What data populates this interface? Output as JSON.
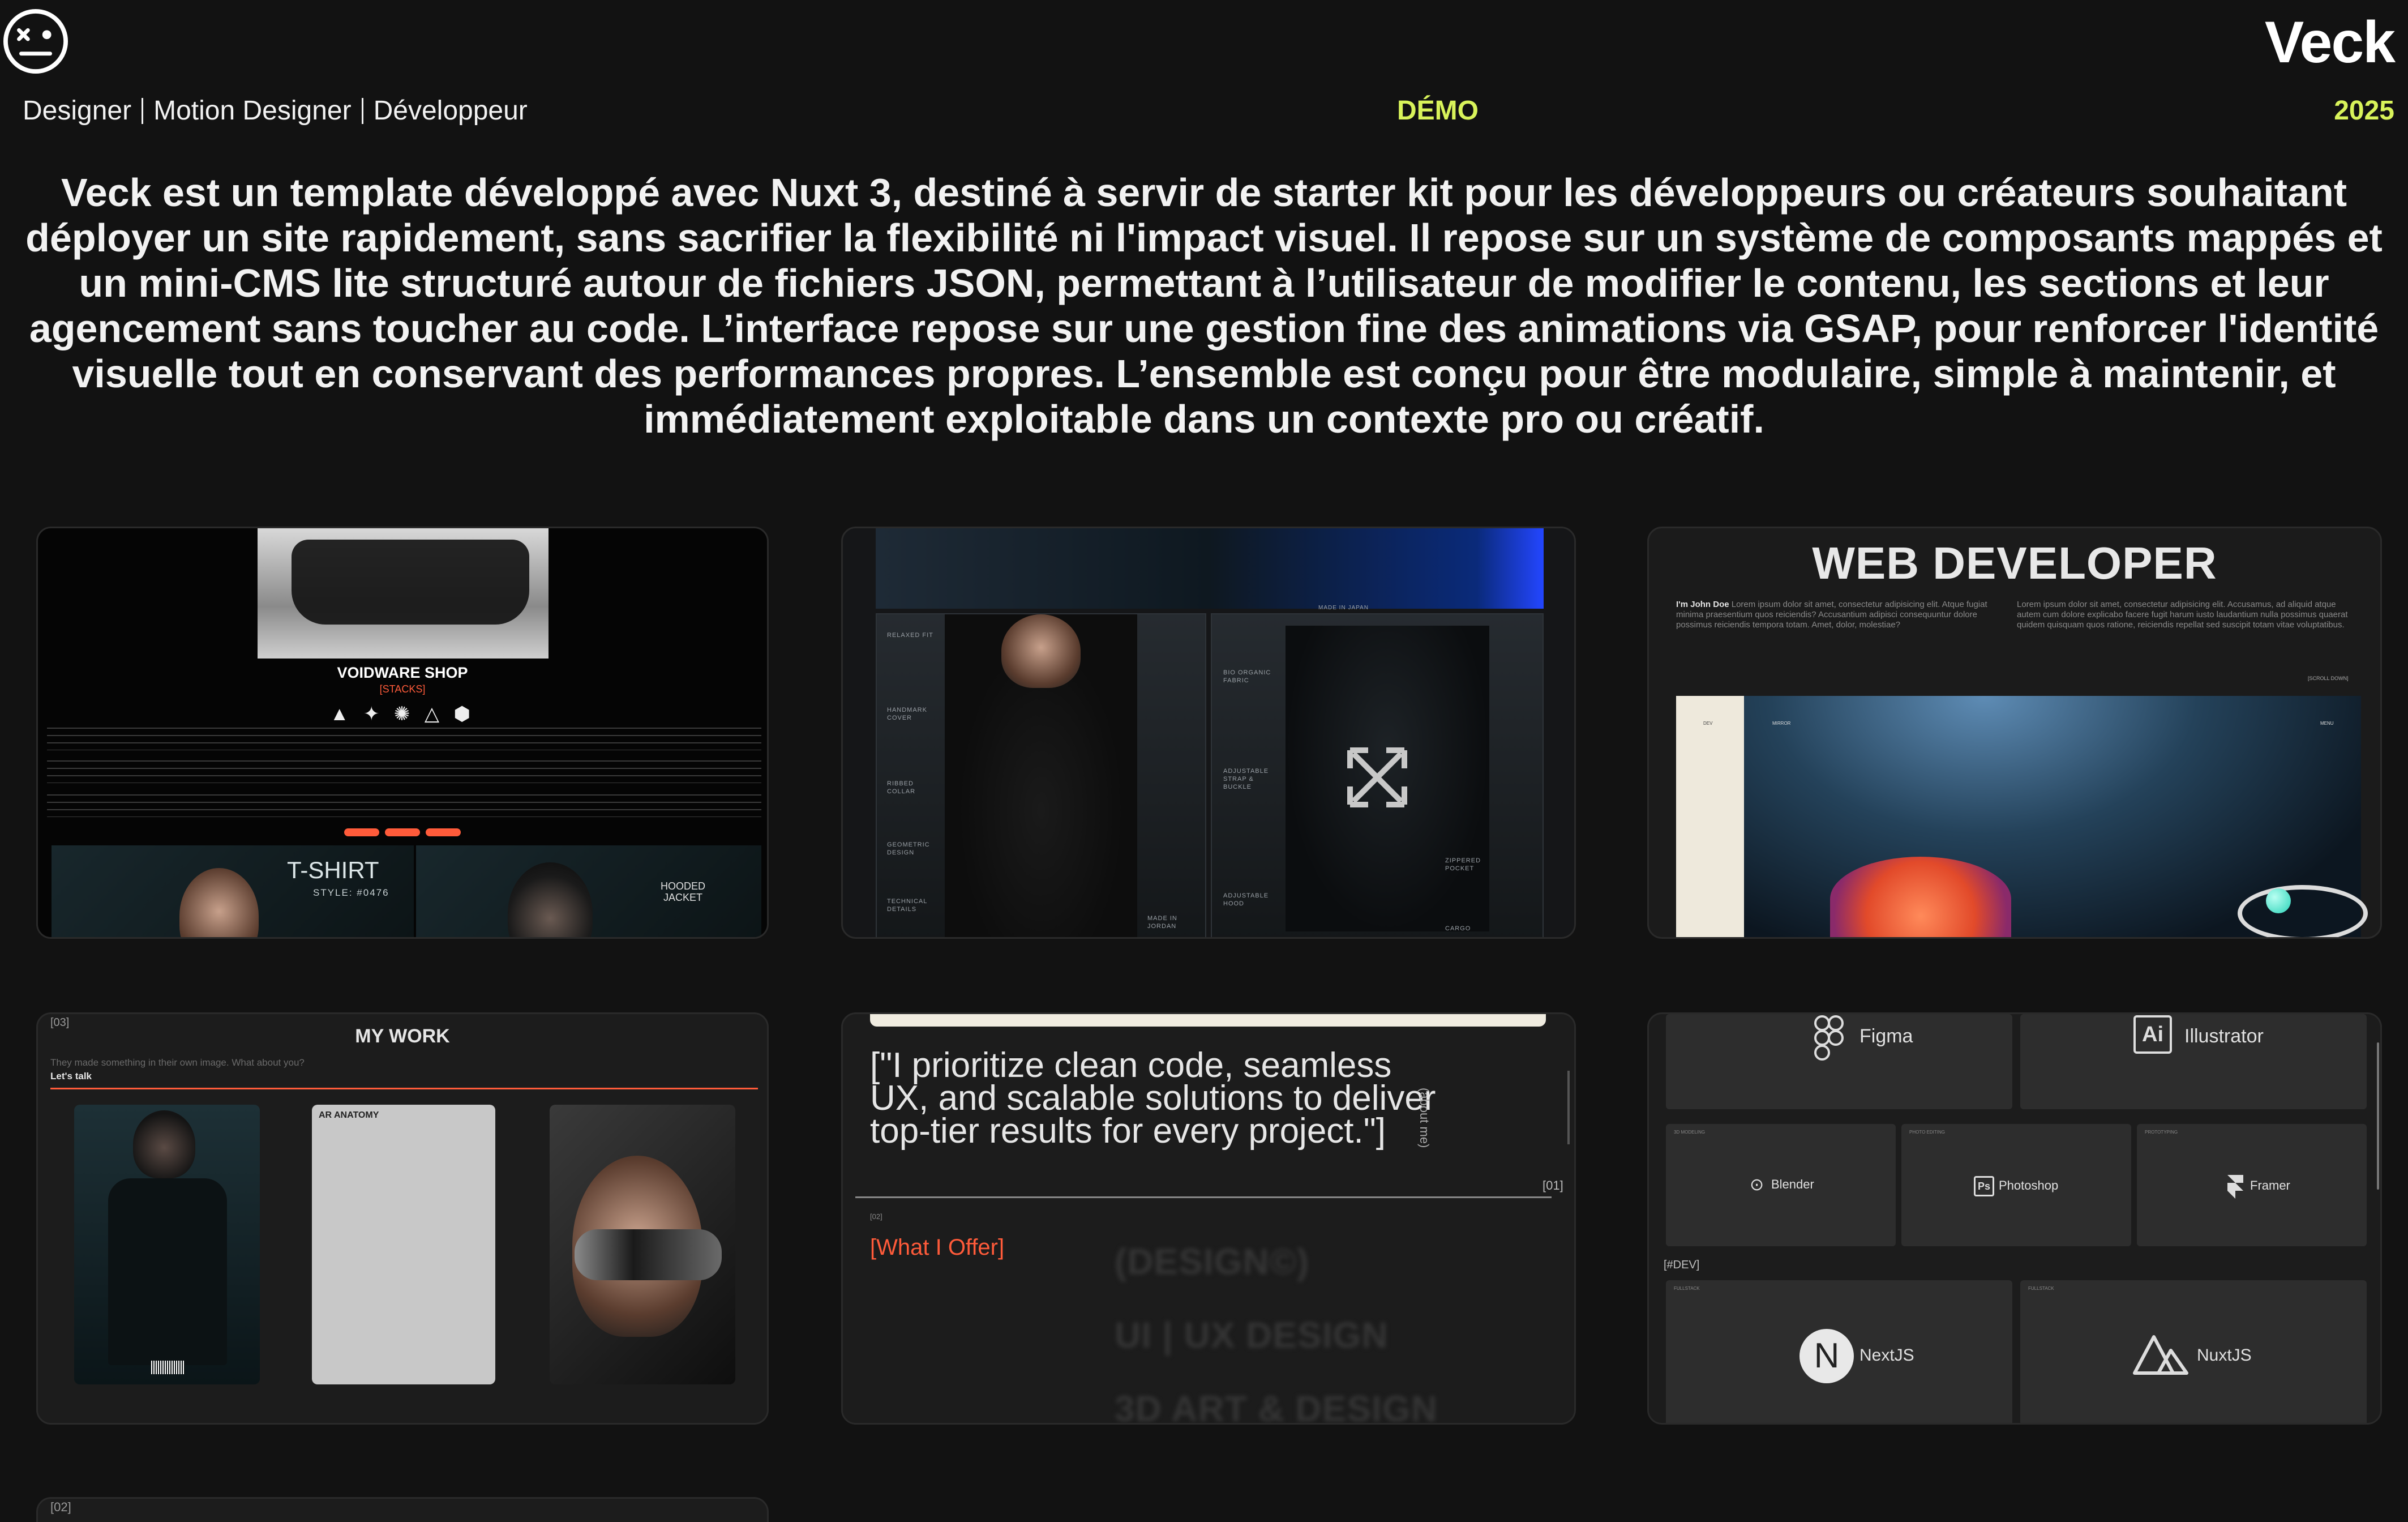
{
  "header": {
    "brand": "Veck",
    "roles": [
      "Designer",
      "Motion Designer",
      "Développeur"
    ],
    "demo": "DÉMO",
    "year": "2025"
  },
  "intro": "Veck est un template développé avec Nuxt 3, destiné à servir de starter kit pour les développeurs ou créateurs souhaitant déployer un site rapidement, sans sacrifier la flexibilité ni l'impact visuel. Il repose sur un système de composants mappés et un mini-CMS lite structuré autour de fichiers JSON, permettant à l’utilisateur de modifier le contenu, les sections et leur agencement sans toucher au code. L’interface repose sur une gestion fine des animations via GSAP, pour renforcer l'identité visuelle tout en conservant des performances propres. L’ensemble est conçu pour être modulaire, simple à maintenir, et immédiatement exploitable dans un contexte pro ou créatif.",
  "colors": {
    "accent": "#d8f35a",
    "orange": "#ff5b3a",
    "background": "#121212"
  },
  "cards": {
    "shop": {
      "title": "VOIDWARE SHOP",
      "subtitle": "[STACKS]",
      "tshirt": "T-SHIRT",
      "style": "STYLE: #0476",
      "hooded": "HOODED\nJACKET"
    },
    "apparel": {
      "labels_left": [
        "RELAXED FIT",
        "HANDMARK COVER",
        "RIBBED COLLAR",
        "GEOMETRIC DESIGN",
        "TECHNICAL DETAILS"
      ],
      "made_left": "MADE IN\nJORDAN",
      "made_top": "MADE IN JAPAN",
      "labels_right": [
        "BIO ORGANIC FABRIC",
        "ADJUSTABLE STRAP & BUCKLE",
        "ADJUSTABLE HOOD"
      ],
      "zippered": "ZIPPERED\nPOCKET",
      "cargo": "CARGO"
    },
    "webdev": {
      "title": "WEB DEVELOPER",
      "name": "I'm John Doe",
      "left_text": "Lorem ipsum dolor sit amet, consectetur adipisicing elit. Atque fugiat minima praesentium quos reiciendis? Accusantium adipisci consequuntur dolore possimus reiciendis tempora totam. Amet, dolor, molestiae?",
      "right_text": "Lorem ipsum dolor sit amet, consectetur adipisicing elit. Accusamus, ad aliquid atque autem cum dolore explicabo facere fugit harum iusto laudantium nulla possimus quaerat quidem quisquam quos ratione, reiciendis repellat sed suscipit totam vitae voluptatibus.",
      "scroll": "[SCROLL DOWN]",
      "nav_left": "DEV",
      "nav_mid": "MIRROR",
      "nav_right": "MENU"
    },
    "work": {
      "index": "[03]",
      "title": "MY WORK",
      "sub": "They made something in their own image. What about you?",
      "lets": "Let's talk",
      "tile2": "AR ANATOMY"
    },
    "about": {
      "quote": "[\"I prioritize clean code, seamless UX, and scalable solutions to deliver top-tier results for every project.\"]",
      "about": "(about me)",
      "index01": "[01]",
      "index02": "[02]",
      "offer": "[What I Offer]",
      "blur1": "(DESIGN©)",
      "blur2": "UI | UX DESIGN",
      "blur3": "3D ART & DESIGN"
    },
    "tools": {
      "figma": "Figma",
      "illustrator": "Illustrator",
      "blender": "Blender",
      "photoshop": "Photoshop",
      "framer": "Framer",
      "dev_tag": "[#DEV]",
      "next": "NextJS",
      "nuxt": "NuxtJS",
      "mini_3d": "3D MODELING",
      "mini_photo": "PHOTO EDITING",
      "mini_proto": "PROTOTYPING",
      "mini_full1": "FULLSTACK",
      "mini_full2": "FULLSTACK"
    },
    "bottom": {
      "index": "[02]"
    }
  }
}
